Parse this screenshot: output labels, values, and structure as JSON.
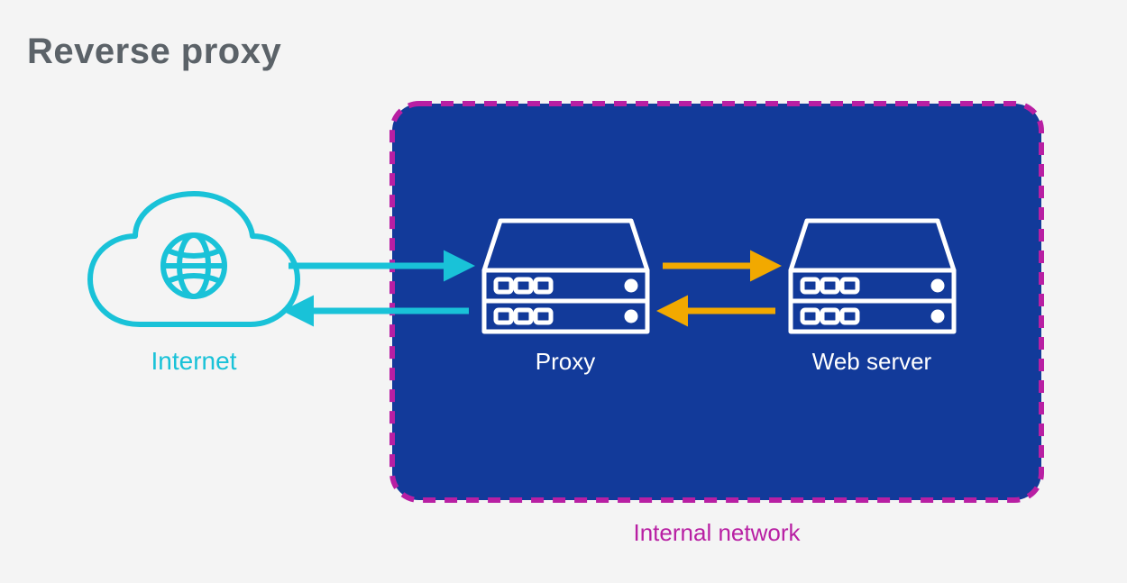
{
  "title": "Reverse proxy",
  "nodes": {
    "internet": {
      "label": "Internet"
    },
    "proxy": {
      "label": "Proxy"
    },
    "webserver": {
      "label": "Web server"
    },
    "network": {
      "label": "Internal network"
    }
  },
  "colors": {
    "title": "#5b6268",
    "border_dash": "#b81fa3",
    "panel_fill": "#123a9a",
    "cyan": "#19c2d8",
    "yellow": "#f2a900",
    "white": "#ffffff",
    "internal_label": "#b81fa3"
  }
}
